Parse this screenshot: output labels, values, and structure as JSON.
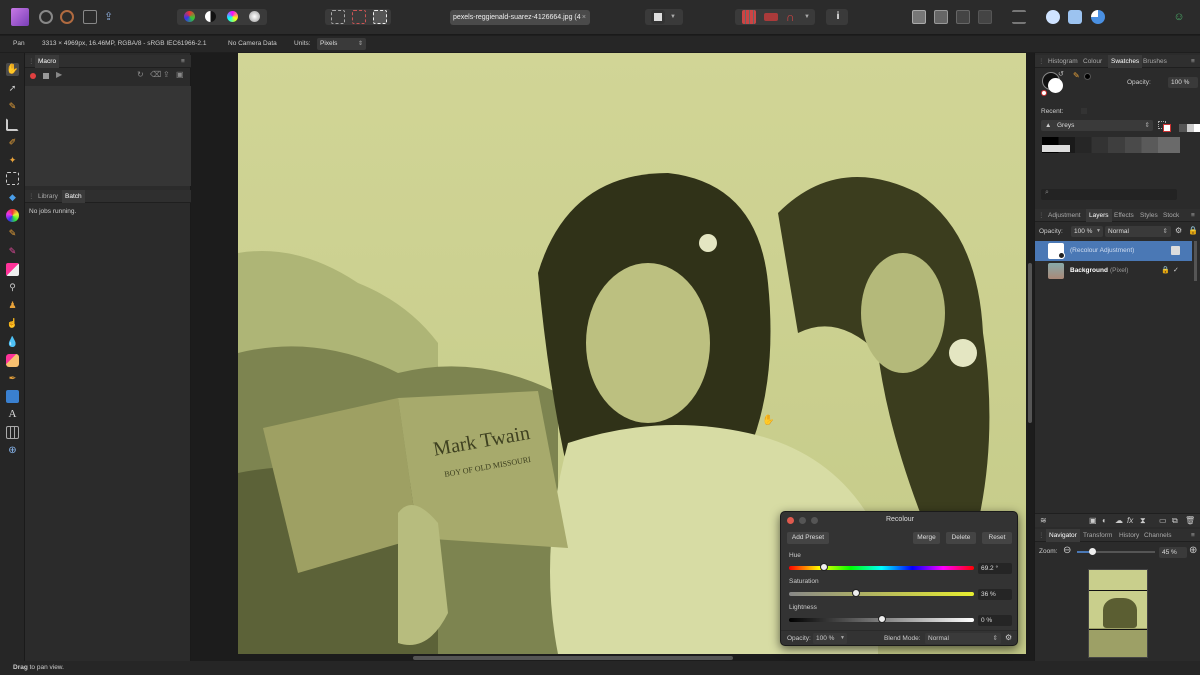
{
  "document": {
    "tab_label": "pexels-reggienald-suarez-4126664.jpg (4",
    "tab_close": "×"
  },
  "context_bar": {
    "tool_name": "Pan",
    "image_info": "3313 × 4969px, 16.46MP, RGBA/8 - sRGB IEC61966-2.1",
    "camera": "No Camera Data",
    "units_label": "Units:",
    "units_value": "Pixels"
  },
  "left_panel": {
    "macro_tab": "Macro",
    "library_tab": "Library",
    "batch_tab": "Batch",
    "batch_status": "No jobs running."
  },
  "right_panel": {
    "top_tabs": [
      "Histogram",
      "Colour",
      "Swatches",
      "Brushes"
    ],
    "opacity_label": "Opacity:",
    "opacity_value": "100 %",
    "recent_label": "Recent:",
    "palette_name": "Greys",
    "layer_tabs": [
      "Adjustment",
      "Layers",
      "Effects",
      "Styles",
      "Stock"
    ],
    "layer_opacity_label": "Opacity:",
    "layer_opacity_value": "100 %",
    "layer_blend": "Normal",
    "layers": [
      {
        "name": "(Recolour Adjustment)",
        "selected": true
      },
      {
        "name": "Background",
        "suffix": "(Pixel)",
        "selected": false
      }
    ],
    "nav_tabs": [
      "Navigator",
      "Transform",
      "History",
      "Channels"
    ],
    "zoom_label": "Zoom:",
    "zoom_value": "45 %"
  },
  "recolour_dialog": {
    "title": "Recolour",
    "add_preset": "Add Preset",
    "merge": "Merge",
    "delete": "Delete",
    "reset": "Reset",
    "hue_label": "Hue",
    "hue_value": "69.2 °",
    "hue_fraction": 0.19,
    "saturation_label": "Saturation",
    "saturation_value": "36 %",
    "saturation_fraction": 0.36,
    "lightness_label": "Lightness",
    "lightness_value": "0 %",
    "lightness_fraction": 0.5,
    "opacity_label": "Opacity:",
    "opacity_value": "100 %",
    "blend_label": "Blend Mode:",
    "blend_value": "Normal"
  },
  "photo": {
    "book_title": "Mark Twain",
    "book_subtitle": "BOY OF OLD MISSOURI"
  },
  "status_bar": {
    "bold": "Drag",
    "text": " to pan view."
  },
  "colors": {
    "accent": "#4a78b5",
    "tint": "#c9cf8c",
    "close_red": "#e05a4e"
  }
}
